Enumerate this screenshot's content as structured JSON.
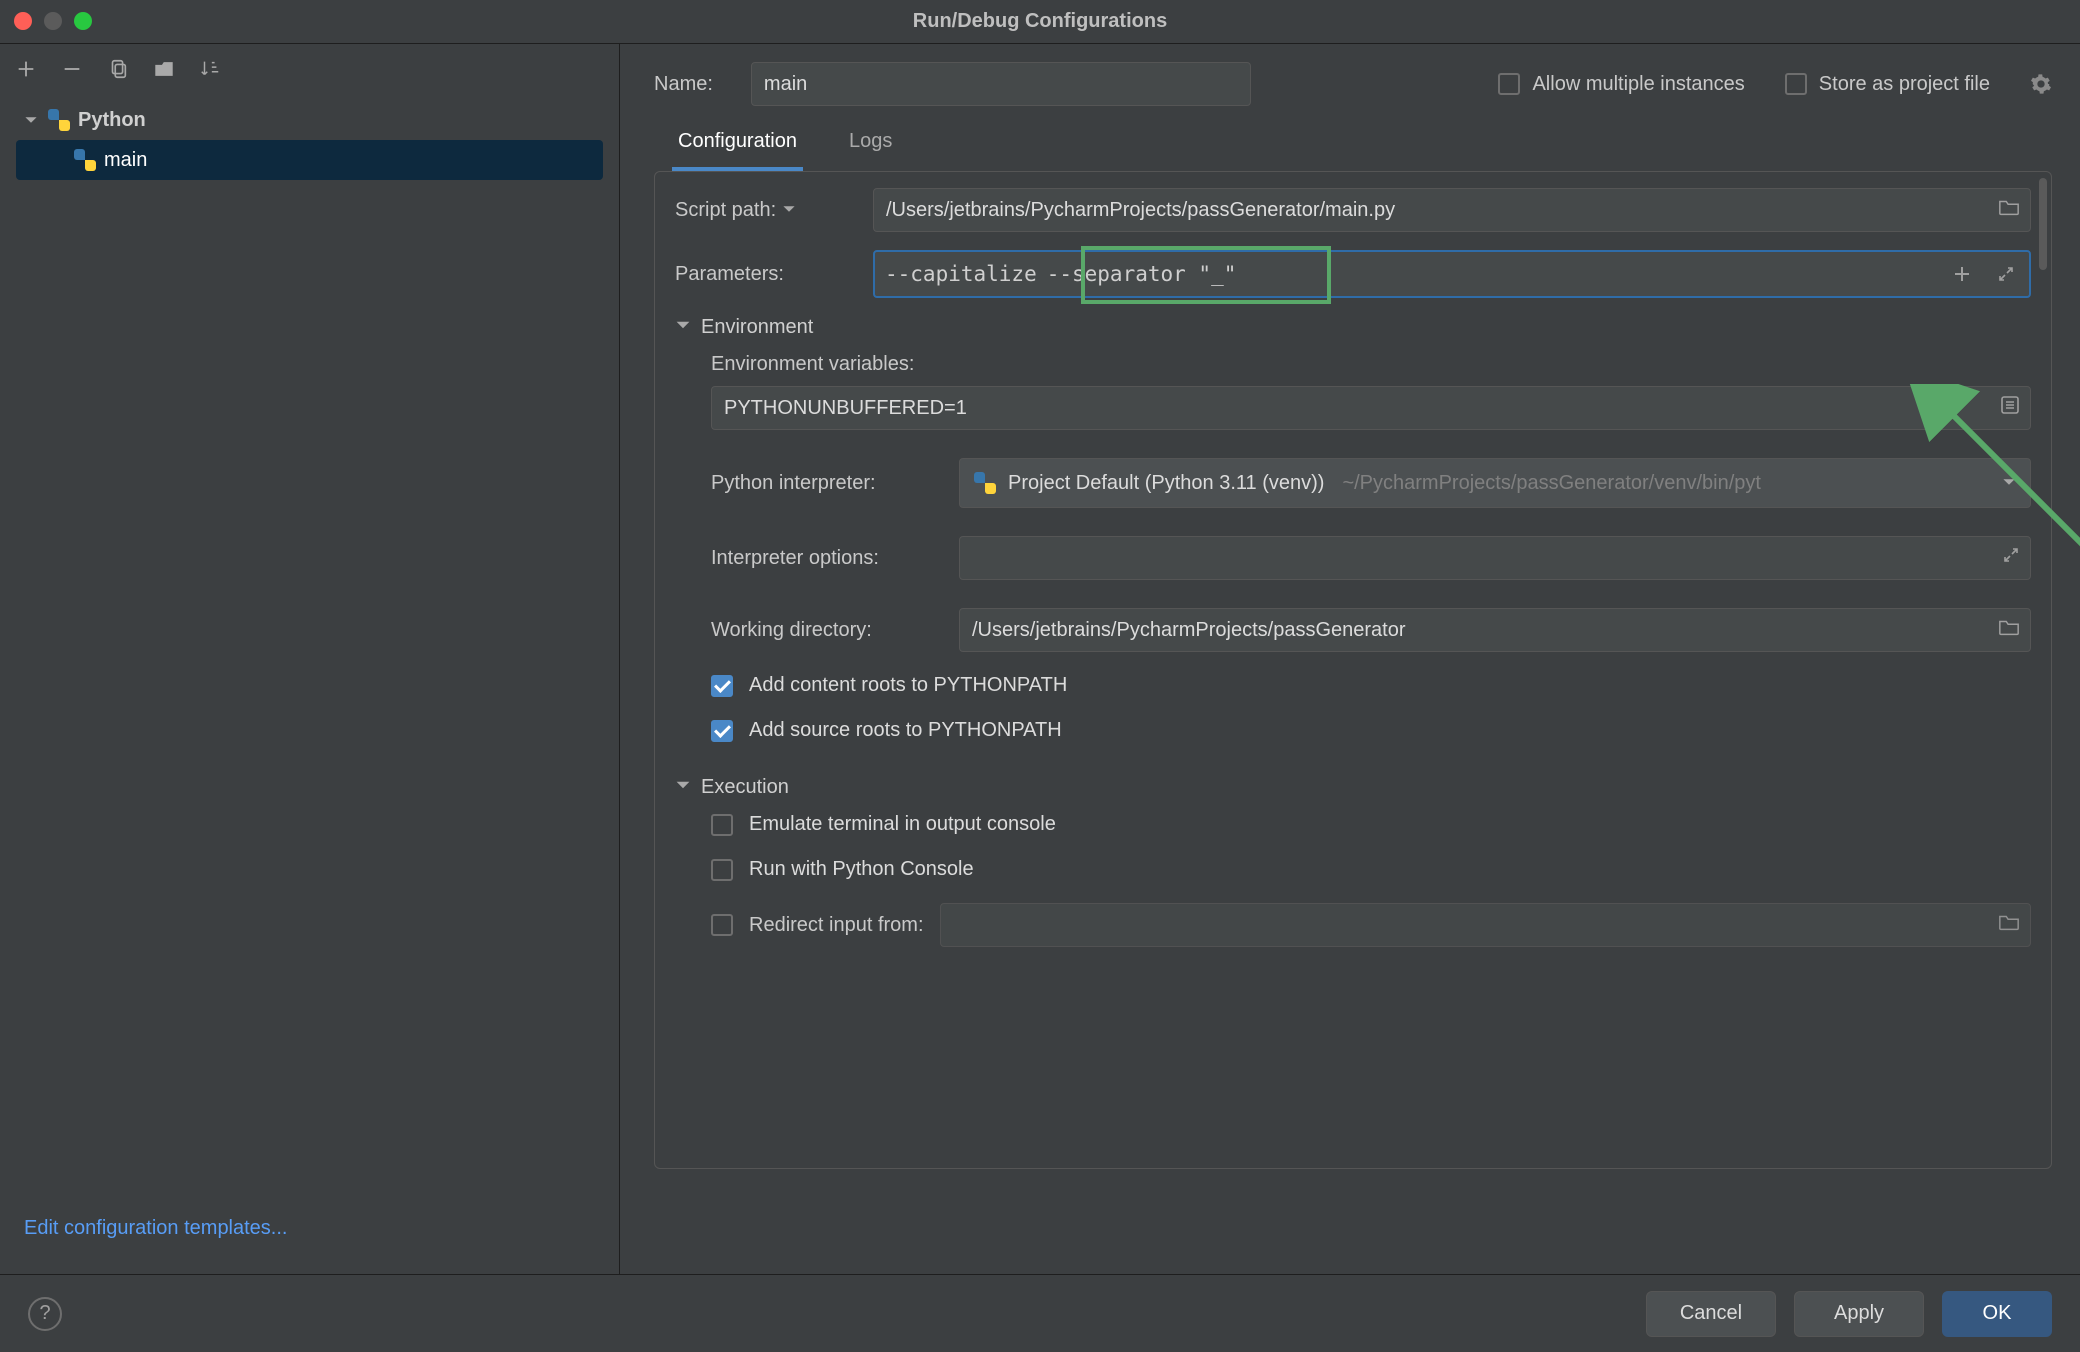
{
  "title": "Run/Debug Configurations",
  "sidebar": {
    "group_label": "Python",
    "items": [
      {
        "label": "main"
      }
    ],
    "edit_templates": "Edit configuration templates..."
  },
  "header": {
    "name_label": "Name:",
    "name_value": "main",
    "allow_multiple_label": "Allow multiple instances",
    "store_project_label": "Store as project file"
  },
  "tabs": {
    "configuration": "Configuration",
    "logs": "Logs"
  },
  "form": {
    "script_path_label": "Script path:",
    "script_path_value": "/Users/jetbrains/PycharmProjects/passGenerator/main.py",
    "parameters_label": "Parameters:",
    "parameters_value_a": "--capitalize",
    "parameters_value_b": "--separator \"_\"",
    "env_section": "Environment",
    "env_vars_label": "Environment variables:",
    "env_vars_value": "PYTHONUNBUFFERED=1",
    "interpreter_label": "Python interpreter:",
    "interpreter_value": "Project Default (Python 3.11 (venv))",
    "interpreter_dim": "~/PycharmProjects/passGenerator/venv/bin/pyt",
    "interpreter_options_label": "Interpreter options:",
    "working_dir_label": "Working directory:",
    "working_dir_value": "/Users/jetbrains/PycharmProjects/passGenerator",
    "content_roots_label": "Add content roots to PYTHONPATH",
    "source_roots_label": "Add source roots to PYTHONPATH",
    "execution_section": "Execution",
    "emulate_terminal_label": "Emulate terminal in output console",
    "python_console_label": "Run with Python Console",
    "redirect_input_label": "Redirect input from:"
  },
  "footer": {
    "cancel": "Cancel",
    "apply": "Apply",
    "ok": "OK"
  }
}
